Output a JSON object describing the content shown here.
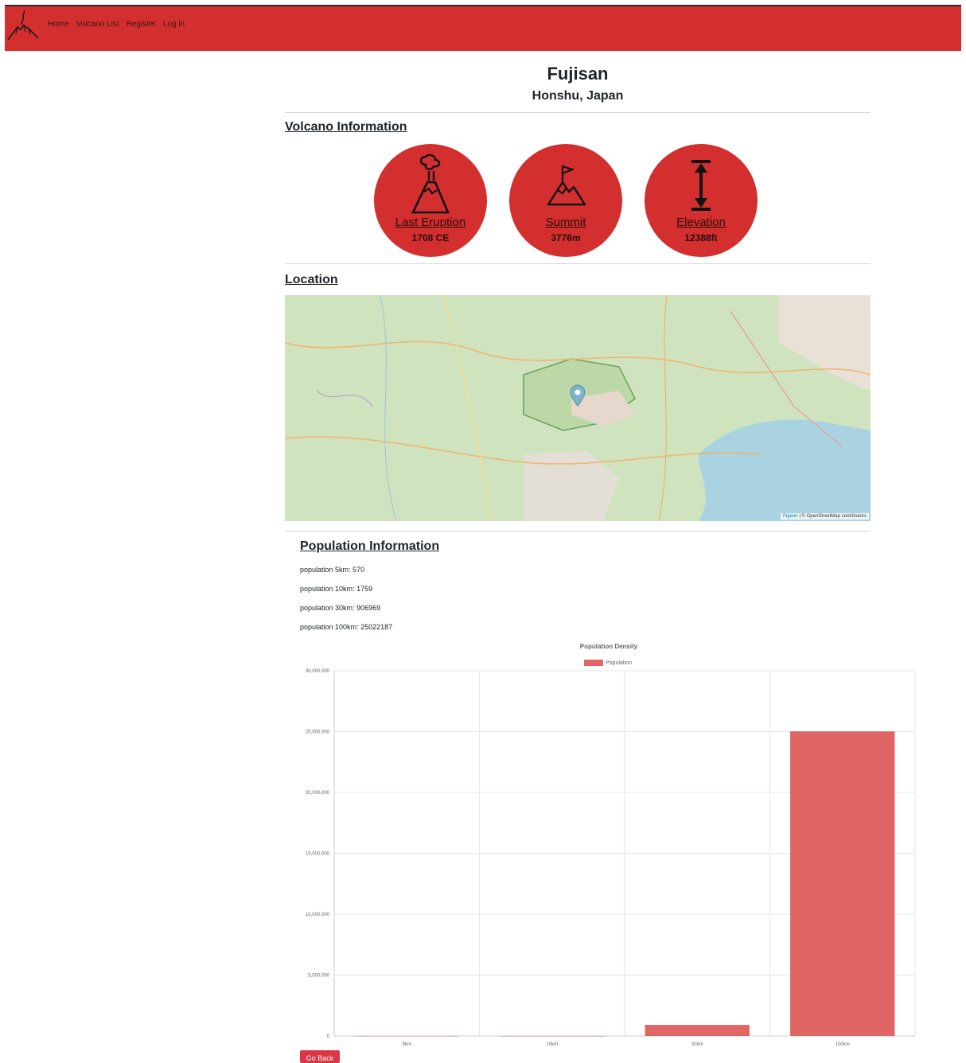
{
  "nav": {
    "items": [
      {
        "label": "Home"
      },
      {
        "label": "Volcano List"
      },
      {
        "label": "Register"
      },
      {
        "label": "Log in"
      }
    ]
  },
  "volcano": {
    "name": "Fujisan",
    "location": "Honshu, Japan"
  },
  "sections": {
    "info_heading": "Volcano Information",
    "location_heading": "Location",
    "population_heading": "Population Information"
  },
  "stats": [
    {
      "label": "Last Eruption",
      "value": "1708 CE",
      "icon": "volcano-icon"
    },
    {
      "label": "Summit",
      "value": "3776m",
      "icon": "mountain-flag-icon"
    },
    {
      "label": "Elevation",
      "value": "12388ft",
      "icon": "elevation-arrow-icon"
    }
  ],
  "map": {
    "marker": "map-pin-icon",
    "attribution_link": "Pigeon",
    "attribution_text": "| © OpenStreetMap contributors"
  },
  "population": [
    {
      "label": "population 5km:",
      "value": "570"
    },
    {
      "label": "population 10km:",
      "value": "1759"
    },
    {
      "label": "population 30km:",
      "value": "906969"
    },
    {
      "label": "population 100km:",
      "value": "25022187"
    }
  ],
  "colors": {
    "brand": "#d32f2f",
    "bar": "#e06666",
    "button": "#dc3545"
  },
  "chart_data": {
    "type": "bar",
    "title": "Population Density",
    "categories": [
      "5km",
      "10km",
      "30km",
      "100km"
    ],
    "series": [
      {
        "name": "Population",
        "values": [
          570,
          1759,
          906969,
          25022187
        ]
      }
    ],
    "ylim": [
      0,
      30000000
    ],
    "yticks": [
      "0",
      "5,000,000",
      "10,000,000",
      "15,000,000",
      "20,000,000",
      "25,000,000",
      "30,000,000"
    ],
    "ytick_values": [
      0,
      5000000,
      10000000,
      15000000,
      20000000,
      25000000,
      30000000
    ],
    "grid": true,
    "legend": "top"
  },
  "buttons": {
    "go_back": "Go Back"
  }
}
